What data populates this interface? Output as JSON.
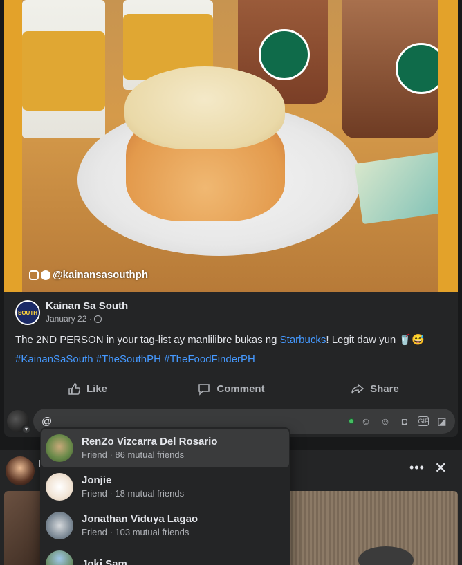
{
  "post": {
    "watermark": "@kainansasouthph",
    "page_avatar_text": "SOUTH",
    "author": "Kainan Sa South",
    "date": "January 22 ·",
    "text_before": "The 2ND PERSON in your tag-list ay manlilibre bukas ng ",
    "text_link": "Starbucks",
    "text_after": "! Legit daw yun 🥤😅",
    "hashtags": "#KainanSaSouth #TheSouthPH #TheFoodFinderPH",
    "actions": {
      "like": "Like",
      "comment": "Comment",
      "share": "Share"
    },
    "comment_input": "@"
  },
  "post2": {
    "author_initial": "N",
    "more": "•••",
    "close": "✕"
  },
  "mentions": [
    {
      "name": "RenZo Vizcarra Del Rosario",
      "sub": "Friend · 86 mutual friends",
      "color": "#6a8a4a"
    },
    {
      "name": "Jonjie",
      "sub": "Friend · 18 mutual friends",
      "color": "#f2e6d8"
    },
    {
      "name": "Jonathan Viduya Lagao",
      "sub": "Friend · 103 mutual friends",
      "color": "#7d8a96"
    },
    {
      "name": "Joki Sam",
      "sub": "",
      "color": "#6b8f6a"
    }
  ],
  "colors": {
    "background": "#18191a",
    "card": "#242526",
    "link": "#4599ff",
    "input": "#3a3b3c",
    "banner": "#e3a22a"
  },
  "icons": [
    "thumbs-up-icon",
    "comment-icon",
    "share-icon",
    "globe-icon",
    "emoji-icon",
    "camera-icon",
    "gif-icon",
    "sticker-icon",
    "avatar-sticker-icon"
  ]
}
